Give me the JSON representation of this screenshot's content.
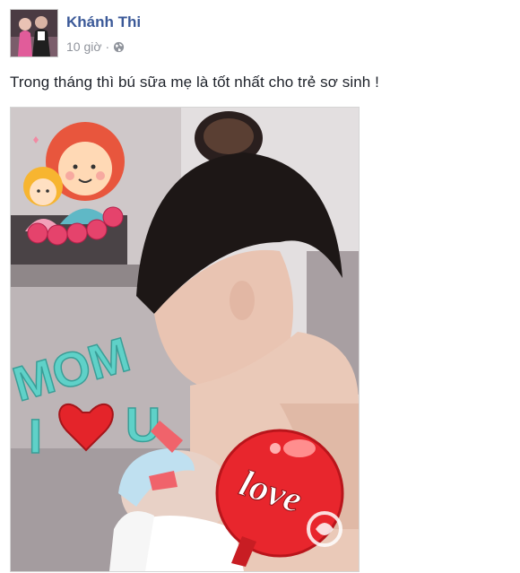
{
  "post": {
    "author": "Khánh Thi",
    "time": "10 giờ",
    "separator": "·",
    "privacy_icon": "globe-icon",
    "caption": "Trong tháng thì bú sữa mẹ là tốt nhất cho trẻ sơ sinh !"
  },
  "photo": {
    "sticker_mom_text": "MOM",
    "sticker_i_text": "I",
    "sticker_u_text": "U",
    "sticker_love_text": "love"
  },
  "colors": {
    "author_link": "#3b5998",
    "meta_gray": "#90949c",
    "sticker_teal": "#5fd1c8",
    "heart_red": "#e4242a"
  }
}
